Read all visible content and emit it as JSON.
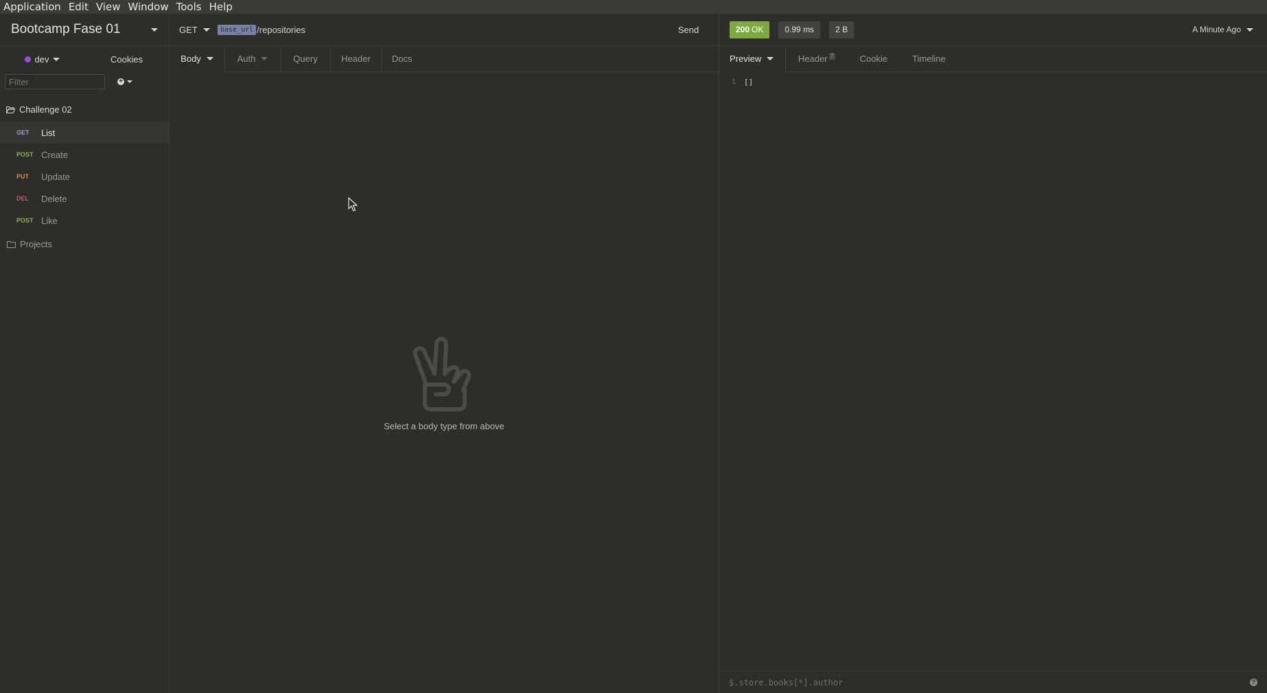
{
  "menubar": {
    "items": [
      {
        "label": "Application"
      },
      {
        "label": "Edit"
      },
      {
        "label": "View"
      },
      {
        "label": "Window"
      },
      {
        "label": "Tools"
      },
      {
        "label": "Help"
      }
    ]
  },
  "sidebar": {
    "workspace_title": "Bootcamp Fase 01",
    "environment": "dev",
    "environment_color": "#9b4ddb",
    "cookies_label": "Cookies",
    "filter_placeholder": "Filter",
    "folders": [
      {
        "name": "Challenge 02",
        "icon": "folder-open-icon",
        "requests": [
          {
            "method": "GET",
            "name": "List",
            "active": true
          },
          {
            "method": "POST",
            "name": "Create"
          },
          {
            "method": "PUT",
            "name": "Update"
          },
          {
            "method": "DEL",
            "name": "Delete"
          },
          {
            "method": "POST",
            "name": "Like"
          }
        ]
      },
      {
        "name": "Projects",
        "icon": "folder-icon"
      }
    ]
  },
  "request": {
    "method": "GET",
    "url_variable": "base_url",
    "url_path": "/repositories",
    "send_label": "Send",
    "tabs": [
      {
        "label": "Body"
      },
      {
        "label": "Auth"
      },
      {
        "label": "Query"
      },
      {
        "label": "Header"
      },
      {
        "label": "Docs"
      }
    ],
    "empty_message": "Select a body type from above"
  },
  "response": {
    "status_code": "200",
    "status_text": "OK",
    "time": "0.99 ms",
    "size": "2 B",
    "time_ago": "A Minute Ago",
    "tabs": [
      {
        "label": "Preview"
      },
      {
        "label": "Header",
        "count": "7"
      },
      {
        "label": "Cookie"
      },
      {
        "label": "Timeline"
      }
    ],
    "body_lines": [
      {
        "number": "1",
        "text": "[]"
      }
    ],
    "filter_placeholder": "$.store.books[*].author"
  },
  "colors": {
    "status_ok": "#7dab3f",
    "method_get": "#a195cf",
    "method_post": "#8ab54a",
    "method_put": "#d98a3a",
    "method_del": "#e04a52"
  }
}
